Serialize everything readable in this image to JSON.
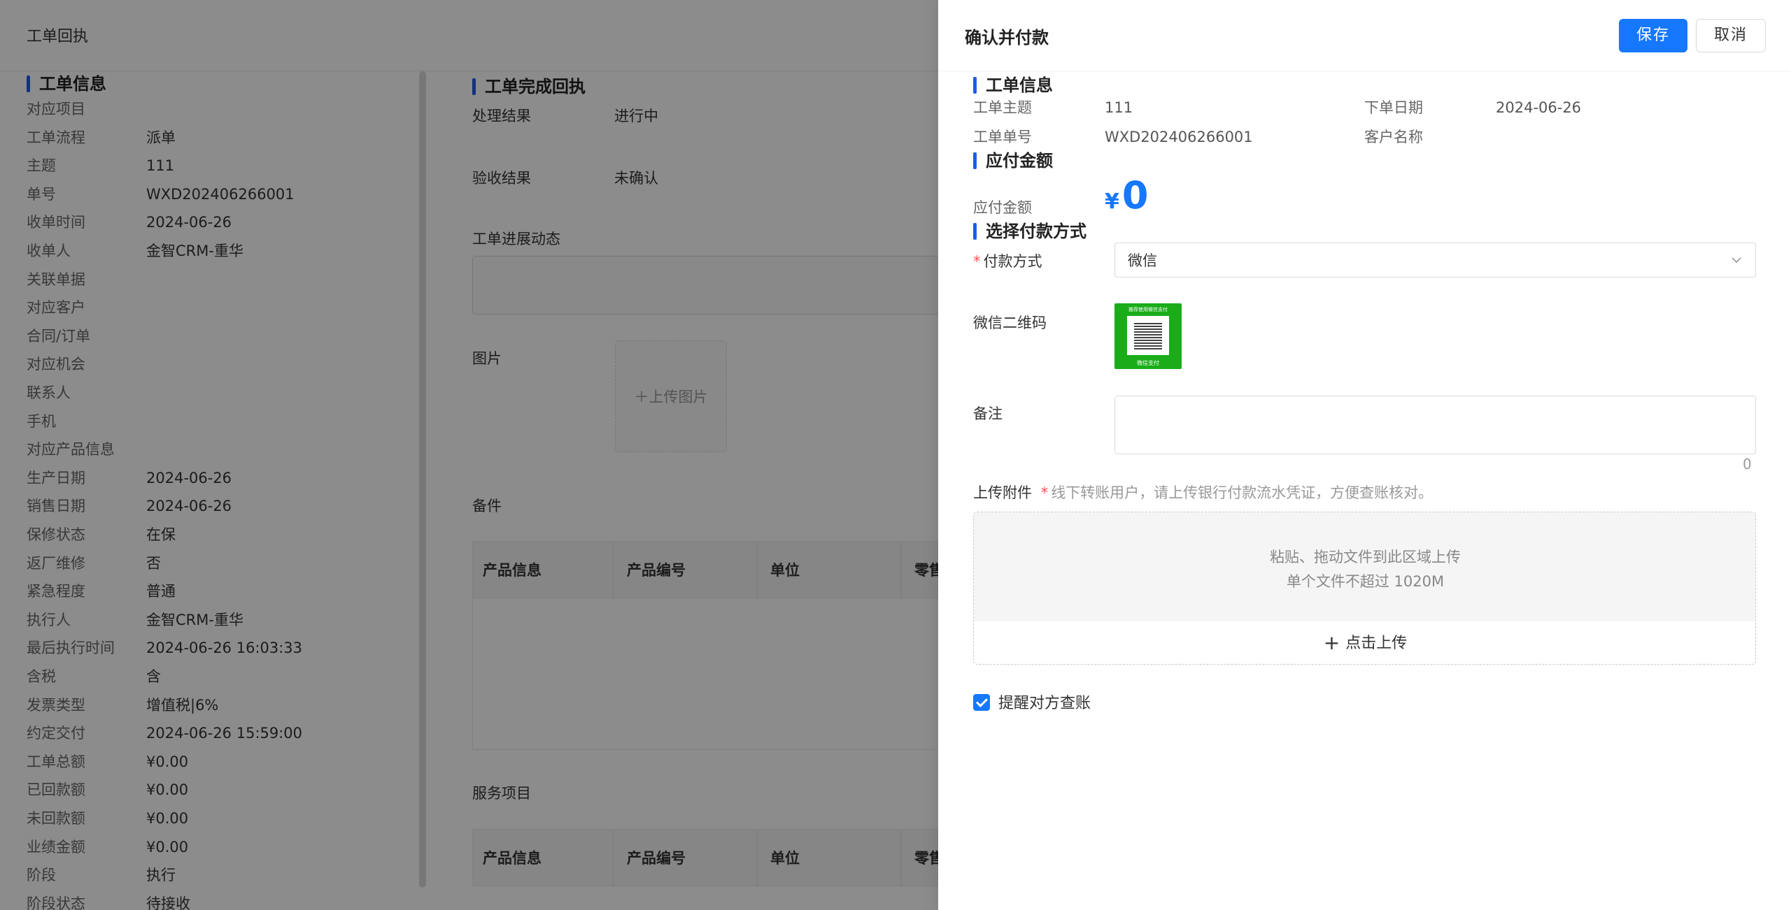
{
  "background": {
    "header_title": "工单回执",
    "left_section_title": "工单信息",
    "info_rows": [
      {
        "label": "对应项目",
        "value": ""
      },
      {
        "label": "工单流程",
        "value": "派单"
      },
      {
        "label": "主题",
        "value": "111"
      },
      {
        "label": "单号",
        "value": "WXD202406266001"
      },
      {
        "label": "收单时间",
        "value": "2024-06-26"
      },
      {
        "label": "收单人",
        "value": "金智CRM-重华"
      },
      {
        "label": "关联单据",
        "value": ""
      },
      {
        "label": "对应客户",
        "value": ""
      },
      {
        "label": "合同/订单",
        "value": ""
      },
      {
        "label": "对应机会",
        "value": ""
      },
      {
        "label": "联系人",
        "value": ""
      },
      {
        "label": "手机",
        "value": ""
      },
      {
        "label": "对应产品信息",
        "value": ""
      },
      {
        "label": "生产日期",
        "value": "2024-06-26"
      },
      {
        "label": "销售日期",
        "value": "2024-06-26"
      },
      {
        "label": "保修状态",
        "value": "在保"
      },
      {
        "label": "返厂维修",
        "value": "否"
      },
      {
        "label": "紧急程度",
        "value": "普通"
      },
      {
        "label": "执行人",
        "value": "金智CRM-重华"
      },
      {
        "label": "最后执行时间",
        "value": "2024-06-26 16:03:33"
      },
      {
        "label": "含税",
        "value": "含"
      },
      {
        "label": "发票类型",
        "value": "增值税|6%"
      },
      {
        "label": "约定交付",
        "value": "2024-06-26 15:59:00"
      },
      {
        "label": "工单总额",
        "value": "¥0.00"
      },
      {
        "label": "已回款额",
        "value": "¥0.00"
      },
      {
        "label": "未回款额",
        "value": "¥0.00"
      },
      {
        "label": "业绩金额",
        "value": "¥0.00"
      },
      {
        "label": "阶段",
        "value": "执行"
      },
      {
        "label": "阶段状态",
        "value": "待接收"
      }
    ],
    "mid_section_title": "工单完成回执",
    "result_label": "处理结果",
    "result_value": "进行中",
    "acceptance_label": "验收结果",
    "acceptance_value": "未确认",
    "progress_label": "工单进展动态",
    "image_label": "图片",
    "upload_image": "＋上传图片",
    "parts_label": "备件",
    "parts_columns": [
      "产品信息",
      "产品编号",
      "单位",
      "零售"
    ],
    "service_label": "服务项目",
    "service_columns": [
      "产品信息",
      "产品编号",
      "单位",
      "零售"
    ]
  },
  "drawer": {
    "title": "确认并付款",
    "save_label": "保存",
    "cancel_label": "取消",
    "section_order": "工单信息",
    "subject_label": "工单主题",
    "subject_value": "111",
    "order_date_label": "下单日期",
    "order_date_value": "2024-06-26",
    "order_no_label": "工单单号",
    "order_no_value": "WXD202406266001",
    "customer_label": "客户名称",
    "customer_value": "",
    "section_amount": "应付金额",
    "amount_label": "应付金额",
    "amount_currency": "¥",
    "amount_value": "0",
    "section_payment": "选择付款方式",
    "required_star": "*",
    "payment_label": "付款方式",
    "payment_value": "微信",
    "qr_label": "微信二维码",
    "qr_top_text": "推荐使用微信支付",
    "qr_bottom_text": "微信支付",
    "remark_label": "备注",
    "remark_counter": "0",
    "attach_label": "上传附件",
    "attach_hint": "线下转账用户，请上传银行付款流水凭证，方便查账核对。",
    "dropzone_line1": "粘贴、拖动文件到此区域上传",
    "dropzone_line2": "单个文件不超过 1020M",
    "upload_button": "点击上传",
    "remind_label": "提醒对方查账",
    "remind_checked": true
  },
  "colors": {
    "primary": "#1677ff",
    "section_marker": "#1f5ce5",
    "overlay": "rgba(0,0,0,0.45)",
    "wechat_green": "#1aad19"
  }
}
